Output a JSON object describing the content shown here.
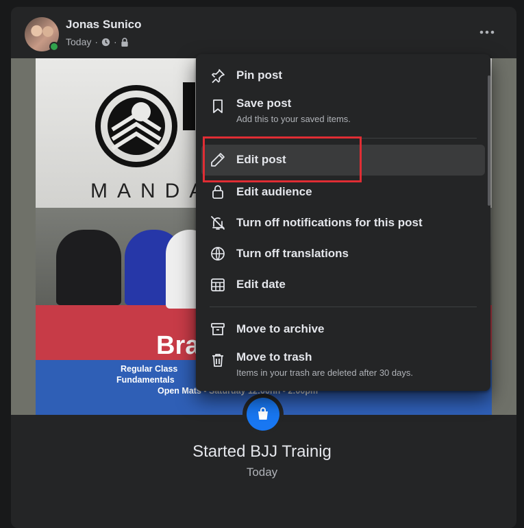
{
  "post": {
    "author": "Jonas Sunico",
    "timestamp": "Today",
    "separator": "·",
    "event_title": "Started BJJ Trainig",
    "event_date": "Today"
  },
  "photo_text": {
    "gym_name_partial": "MANDA",
    "banner_partial": "Bra",
    "lines": [
      "Regular Class",
      "Fundamentals",
      "Open Mats - Saturday 12:00nn - 2:00pm"
    ]
  },
  "menu": {
    "items": [
      {
        "label": "Pin post",
        "icon": "pin-icon"
      },
      {
        "label": "Save post",
        "sub": "Add this to your saved items.",
        "icon": "bookmark-icon"
      },
      {
        "label": "Edit post",
        "icon": "pencil-icon",
        "highlighted": true
      },
      {
        "label": "Edit audience",
        "icon": "lock-icon"
      },
      {
        "label": "Turn off notifications for this post",
        "icon": "bell-off-icon"
      },
      {
        "label": "Turn off translations",
        "icon": "globe-icon"
      },
      {
        "label": "Edit date",
        "icon": "calendar-icon"
      },
      {
        "label": "Move to archive",
        "icon": "archive-icon"
      },
      {
        "label": "Move to trash",
        "sub": "Items in your trash are deleted after 30 days.",
        "icon": "trash-icon"
      }
    ]
  },
  "colors": {
    "background": "#18191a",
    "card": "#242526",
    "highlight": "#3a3b3c",
    "annotation_box": "#e02d34",
    "accent": "#1877f2",
    "online": "#31a24c"
  }
}
